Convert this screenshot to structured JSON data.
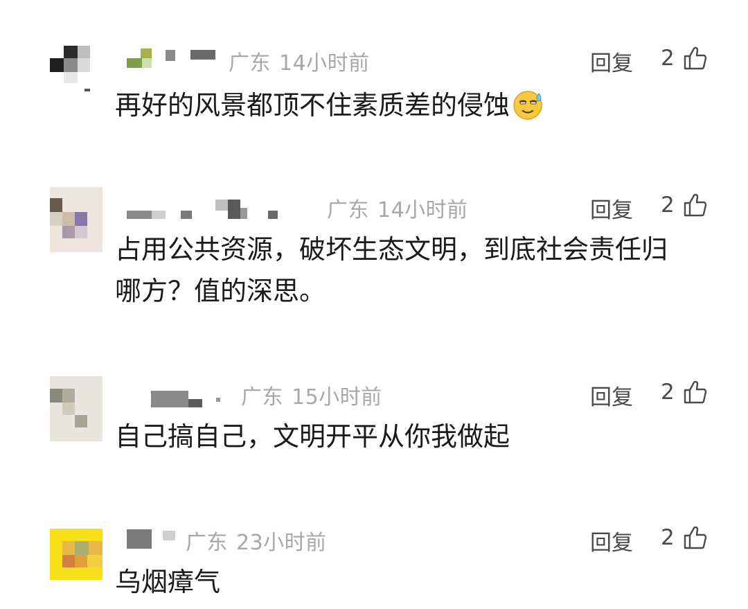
{
  "comments": [
    {
      "location": "广东",
      "time": "14小时前",
      "reply_label": "回复",
      "likes": "2",
      "text": "再好的风景都顶不住素质差的侵蚀",
      "emoji": "sweat-smile-emoji"
    },
    {
      "location": "广东",
      "time": "14小时前",
      "reply_label": "回复",
      "likes": "2",
      "text": "占用公共资源，破坏生态文明，到底社会责任归哪方？值的深思。"
    },
    {
      "location": "广东",
      "time": "15小时前",
      "reply_label": "回复",
      "likes": "2",
      "text": "自己搞自己，文明开平从你我做起"
    },
    {
      "location": "广东",
      "time": "23小时前",
      "reply_label": "回复",
      "likes": "2",
      "text": "乌烟瘴气"
    }
  ],
  "colors": {
    "meta": "#a8a8a8",
    "action": "#4a4a4a",
    "text": "#1a1a1a"
  },
  "icons": {
    "like": "thumbs-up-icon"
  }
}
